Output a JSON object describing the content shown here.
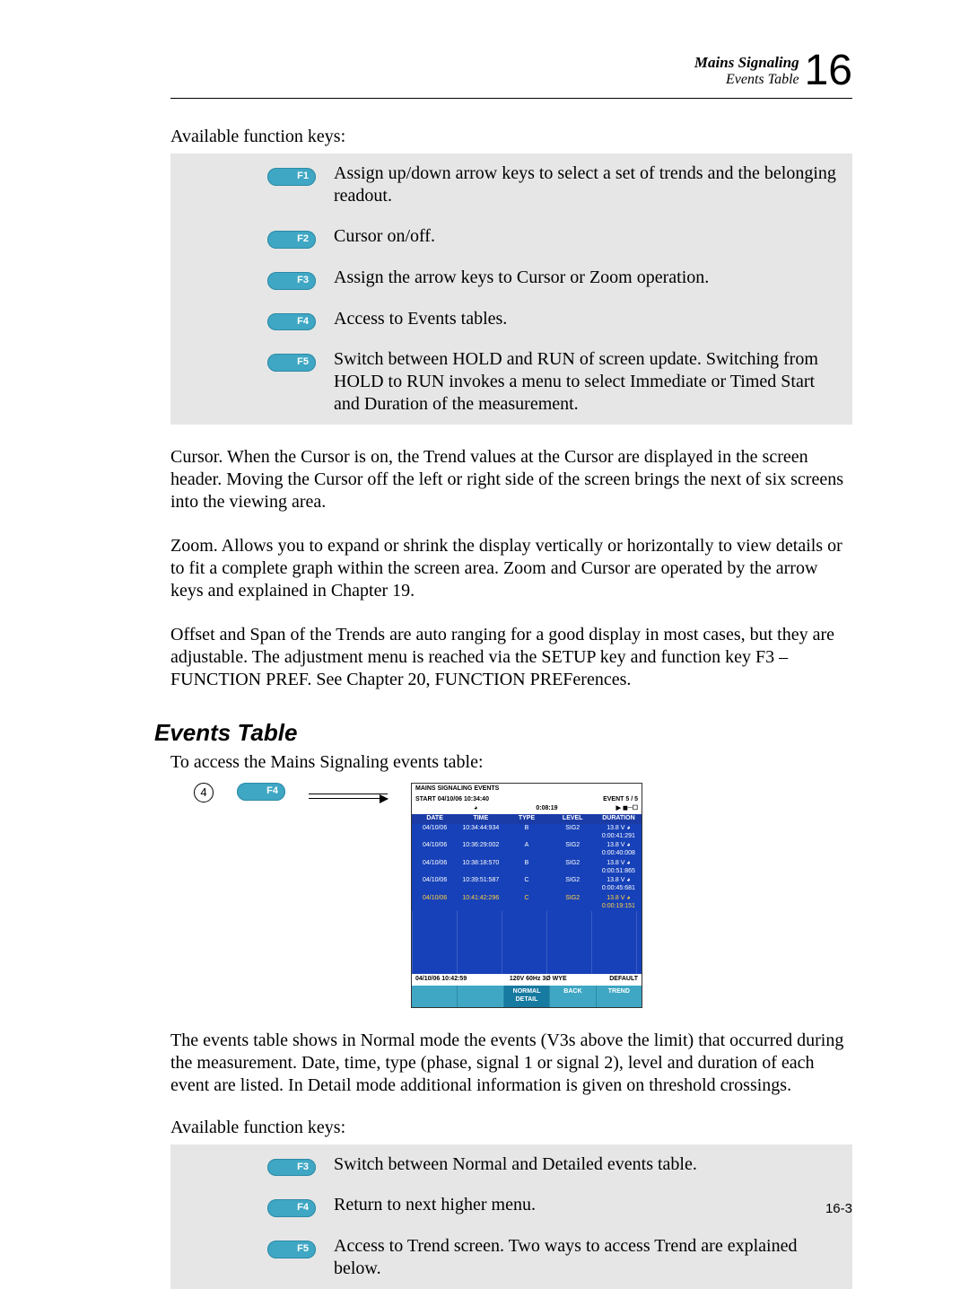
{
  "header": {
    "title": "Mains Signaling",
    "subtitle": "Events Table",
    "chapter": "16"
  },
  "intro1": "Available function keys:",
  "fn1": [
    {
      "key": "F1",
      "desc": "Assign up/down arrow keys to select a set of trends and the belonging readout."
    },
    {
      "key": "F2",
      "desc": "Cursor on/off."
    },
    {
      "key": "F3",
      "desc": "Assign the arrow keys to Cursor or Zoom operation."
    },
    {
      "key": "F4",
      "desc": "Access to Events tables."
    },
    {
      "key": "F5",
      "desc": "Switch between HOLD and RUN of screen update. Switching from HOLD to RUN invokes a menu to select Immediate or Timed Start and Duration of the measurement."
    }
  ],
  "para_cursor": "Cursor. When the Cursor is on, the Trend values at the Cursor are displayed in the screen header. Moving the Cursor off the left or right side of the screen brings the next of six screens into the viewing area.",
  "para_zoom": "Zoom. Allows you to expand or shrink the display vertically or horizontally to view details or to fit a complete graph within the screen area. Zoom and Cursor are operated by the arrow keys and explained in Chapter 19.",
  "para_offset": "Offset and Span of the Trends are auto ranging for a good display in most cases, but they are adjustable. The adjustment menu is reached via the SETUP key and function key F3 – FUNCTION PREF. See Chapter 20, FUNCTION PREFerences.",
  "h2": "Events Table",
  "access_line": "To access the Mains Signaling events table:",
  "step_num": "4",
  "step_key": "F4",
  "shot": {
    "title_l": "MAINS SIGNALING EVENTS",
    "start": "START 04/10/06  10:34:40",
    "event": "EVENT   5 / 5",
    "elapsed_sym": "◕",
    "elapsed": "0:08:19",
    "rec": "▶ ◼─☐",
    "cols": [
      "DATE",
      "TIME",
      "TYPE",
      "LEVEL",
      "DURATION"
    ],
    "rows": [
      [
        "04/10/06",
        "10:34:44:934",
        "B",
        "SIG2",
        "13.8 V ◕ 0:00:41:291"
      ],
      [
        "04/10/06",
        "10:36:29:002",
        "A",
        "SIG2",
        "13.8 V ◕ 0:00:40:008"
      ],
      [
        "04/10/06",
        "10:38:18:570",
        "B",
        "SIG2",
        "13.8 V ◕ 0:00:51:865"
      ],
      [
        "04/10/06",
        "10:39:51:587",
        "C",
        "SIG2",
        "13.8 V ◕ 0:00:45:681"
      ],
      [
        "04/10/06",
        "10:41:42:296",
        "C",
        "SIG2",
        "13.8 V ◕ 0:00:19:151"
      ]
    ],
    "foot_date": "04/10/06  10:42:59",
    "foot_cfg": "120V  60Hz 3Ø WYE",
    "foot_mode": "DEFAULT",
    "btns": [
      "",
      "",
      "NORMAL\nDETAIL",
      "BACK",
      "TREND"
    ]
  },
  "para_table": "The events table shows in Normal mode the events (V3s above the limit) that occurred during the measurement. Date, time, type (phase, signal 1 or signal 2), level and duration of each event are listed. In Detail mode additional information is given on threshold crossings.",
  "intro2": "Available function keys:",
  "fn2": [
    {
      "key": "F3",
      "desc": "Switch between Normal and Detailed events table."
    },
    {
      "key": "F4",
      "desc": "Return to next higher menu."
    },
    {
      "key": "F5",
      "desc": "Access to Trend screen. Two ways to access Trend are explained below."
    }
  ],
  "pagenum": "16-3"
}
